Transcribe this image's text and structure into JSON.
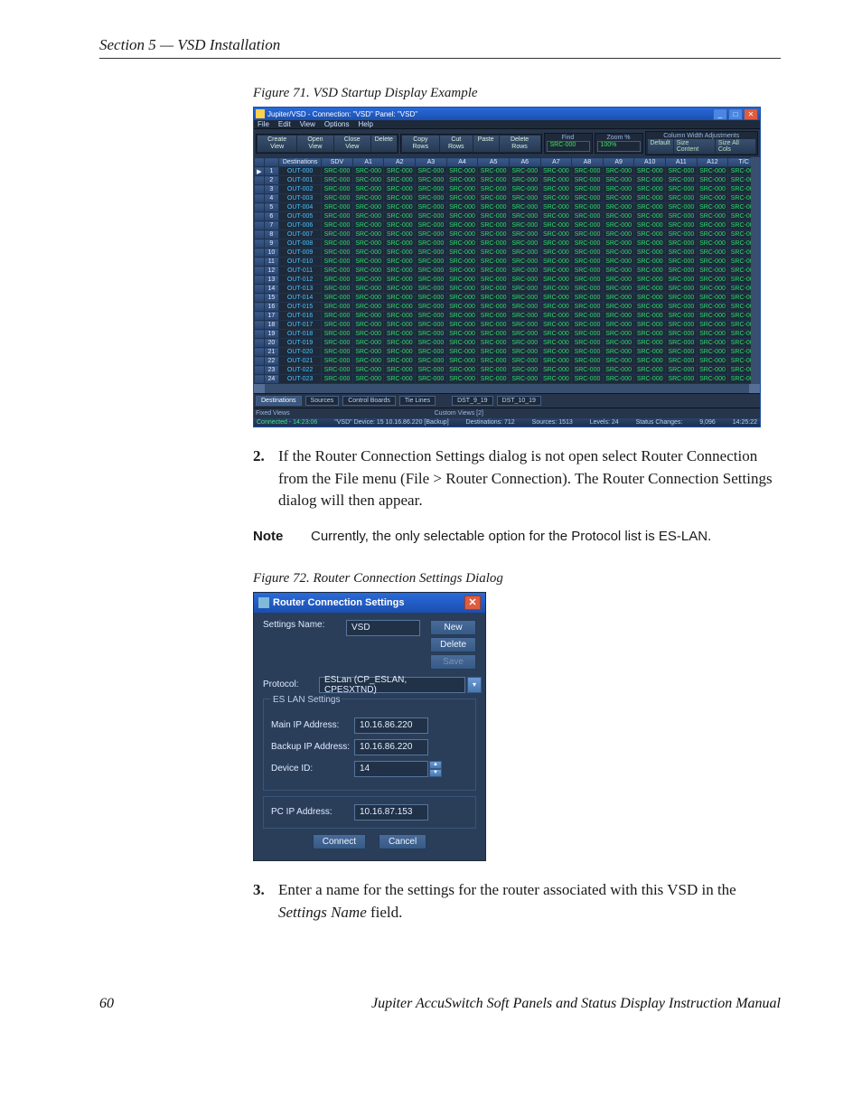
{
  "doc": {
    "section_header": "Section 5 — VSD Installation",
    "fig71_caption": "Figure 71.  VSD Startup Display Example",
    "fig72_caption": "Figure 72.  Router Connection Settings Dialog",
    "step2_num": "2.",
    "step2_text": "If the Router Connection Settings dialog is not open select Router Connection from the File menu (File > Router Connection). The Router Connection Settings dialog will then appear.",
    "note_kw": "Note",
    "note_text": "Currently, the only selectable option for the Protocol list is ES-LAN.",
    "step3_num": "3.",
    "step3_text_a": "Enter a name for the settings for the router associated with this VSD in the ",
    "step3_text_em": "Settings Name",
    "step3_text_b": " field.",
    "footer_page": "60",
    "footer_title": "Jupiter AccuSwitch Soft Panels and Status Display Instruction Manual"
  },
  "vsd": {
    "title": "Jupiter/VSD - Connection: \"VSD\"   Panel: \"VSD\"",
    "menu": {
      "file": "File",
      "edit": "Edit",
      "view": "View",
      "options": "Options",
      "help": "Help"
    },
    "toolbar": {
      "create_view": "Create\nView",
      "open_view": "Open\nView",
      "close_view": "Close\nView",
      "delete": "Delete",
      "copy_rows": "Copy\nRows",
      "cut_rows": "Cut\nRows",
      "paste": "Paste",
      "delete_rows": "Delete\nRows",
      "find_label": "Find",
      "find_value": "SRC-000",
      "zoom_label": "Zoom %",
      "zoom_value": "100%",
      "colwidth_label": "Column Width Adjustments",
      "cw_default": "Default",
      "cw_size_content": "Size Content",
      "cw_size_all_cols": "Size All Cols"
    },
    "grid": {
      "headers": [
        "",
        "",
        "Destinations",
        "SDV",
        "A1",
        "A2",
        "A3",
        "A4",
        "A5",
        "A6",
        "A7",
        "A8",
        "A9",
        "A10",
        "A11",
        "A12",
        "T/C"
      ],
      "row_count": 24,
      "dest_prefix": "OUT-",
      "cell_value": "SRC-000"
    },
    "tabs": {
      "destinations": "Destinations",
      "sources": "Sources",
      "control_boards": "Control Boards",
      "tie_lines": "Tie Lines",
      "fixed_views": "Fixed Views",
      "dst_9_19": "DST_9_19",
      "dst_10_19": "DST_10_19",
      "custom_views": "Custom Views [2]"
    },
    "status": {
      "connected": "Connected - 14:23:06",
      "device": "\"VSD\" Device: 15   10.16.86.220 [Backup]",
      "destinations": "Destinations:  712",
      "sources": "Sources:  1513",
      "levels": "Levels:  24",
      "status_changes": "Status Changes:",
      "changes_val": "9,096",
      "clock": "14:25:22"
    }
  },
  "rcs": {
    "title": "Router Connection Settings",
    "settings_name_label": "Settings Name:",
    "settings_name_value": "VSD",
    "new_btn": "New",
    "delete_btn": "Delete",
    "save_btn": "Save",
    "protocol_label": "Protocol:",
    "protocol_value": "ESLan (CP_ESLAN, CPESXTND)",
    "eslan_legend": "ES LAN Settings",
    "main_ip_label": "Main IP Address:",
    "main_ip_value": "10.16.86.220",
    "backup_ip_label": "Backup IP Address:",
    "backup_ip_value": "10.16.86.220",
    "device_id_label": "Device ID:",
    "device_id_value": "14",
    "pc_ip_label": "PC IP Address:",
    "pc_ip_value": "10.16.87.153",
    "connect_btn": "Connect",
    "cancel_btn": "Cancel"
  }
}
